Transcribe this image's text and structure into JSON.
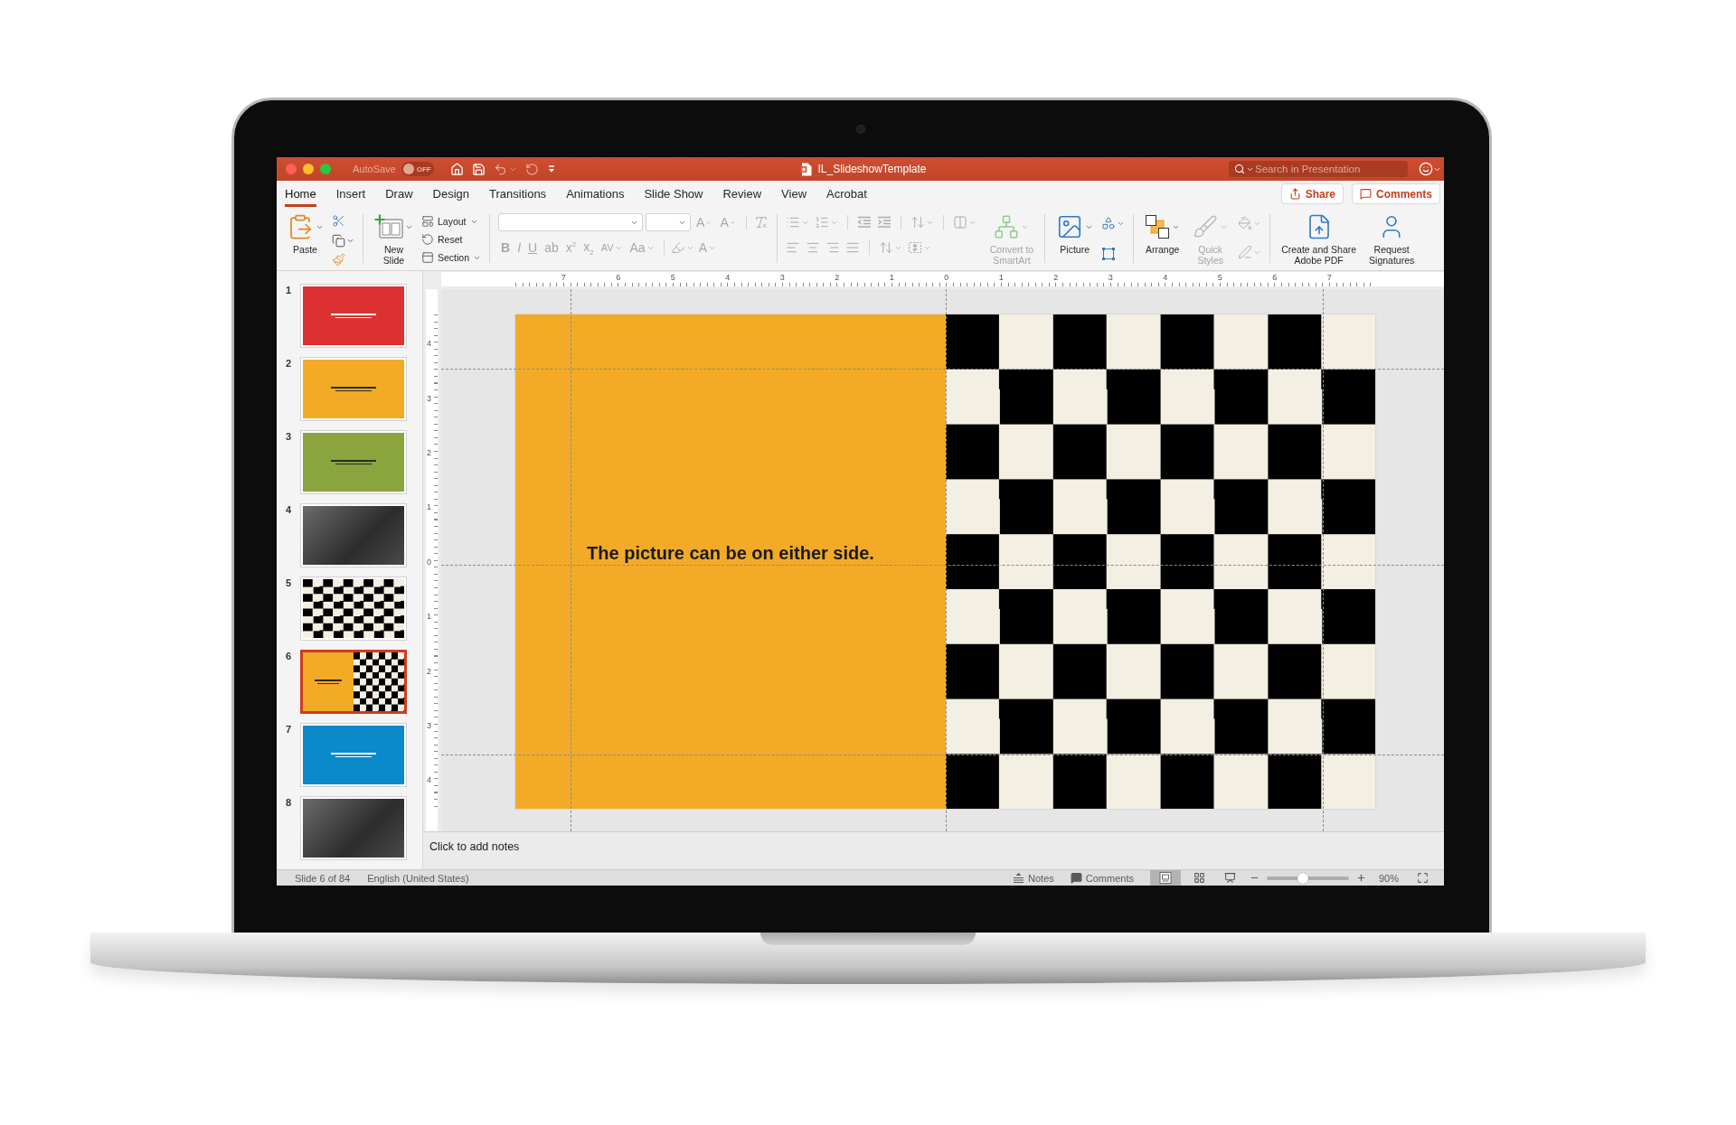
{
  "window": {
    "title": "IL_SlideshowTemplate",
    "autosave": {
      "label": "AutoSave",
      "on": false,
      "toggle_text": "OFF"
    },
    "search": {
      "placeholder": "Search in Presentation"
    }
  },
  "quick_access_toolbar": [
    {
      "kind": "home",
      "disabled": false,
      "dropdown": false
    },
    {
      "kind": "save",
      "disabled": false,
      "dropdown": false
    },
    {
      "kind": "undo",
      "disabled": true,
      "dropdown": true
    },
    {
      "kind": "redo",
      "disabled": true,
      "dropdown": false
    },
    {
      "kind": "customize",
      "disabled": false,
      "dropdown": false
    }
  ],
  "ribbon_tabs": [
    {
      "label": "Home",
      "selected": true
    },
    {
      "label": "Insert",
      "selected": false
    },
    {
      "label": "Draw",
      "selected": false
    },
    {
      "label": "Design",
      "selected": false
    },
    {
      "label": "Transitions",
      "selected": false
    },
    {
      "label": "Animations",
      "selected": false
    },
    {
      "label": "Slide Show",
      "selected": false
    },
    {
      "label": "Review",
      "selected": false
    },
    {
      "label": "View",
      "selected": false
    },
    {
      "label": "Acrobat",
      "selected": false
    }
  ],
  "header_buttons": [
    {
      "kind": "share",
      "label": "Share"
    },
    {
      "kind": "comments",
      "label": "Comments"
    }
  ],
  "ribbon": {
    "paste": {
      "label": "Paste",
      "disabled": false
    },
    "clipboard_buttons": [
      {
        "kind": "cut",
        "disabled": false
      },
      {
        "kind": "copy",
        "disabled": false
      },
      {
        "kind": "format_painter",
        "disabled": false
      }
    ],
    "new_slide": {
      "label": "New\nSlide",
      "disabled": false
    },
    "slide_commands": [
      {
        "kind": "layout",
        "label": "Layout",
        "dropdown": true
      },
      {
        "kind": "reset",
        "label": "Reset",
        "dropdown": false
      },
      {
        "kind": "section",
        "label": "Section",
        "dropdown": true
      }
    ],
    "font": {
      "size_buttons": [
        {
          "kind": "grow",
          "label": "A",
          "disabled": true
        },
        {
          "kind": "shrink",
          "label": "A",
          "disabled": true
        }
      ],
      "clear_button": {
        "disabled": true
      },
      "format_buttons": [
        {
          "kind": "bold",
          "label": "B",
          "disabled": true,
          "dropdown": false
        },
        {
          "kind": "italic",
          "label": "I",
          "disabled": true,
          "dropdown": false
        },
        {
          "kind": "underline",
          "label": "U",
          "disabled": true,
          "dropdown": false
        },
        {
          "kind": "strike",
          "label": "ab",
          "disabled": true,
          "dropdown": false
        },
        {
          "kind": "superscript",
          "label": "x$^{2}$",
          "disabled": true,
          "dropdown": false
        },
        {
          "kind": "subscript",
          "label": "x$_{2}$",
          "disabled": true,
          "dropdown": false
        },
        {
          "kind": "spacing",
          "label": "AV",
          "disabled": true,
          "dropdown": true
        },
        {
          "kind": "case",
          "label": "Aa",
          "disabled": true,
          "dropdown": true
        }
      ],
      "highlight_button": {
        "disabled": true
      },
      "color_button": {
        "label": "A",
        "disabled": true
      }
    },
    "paragraph": {
      "top_row": [
        {
          "buttons": [
            {
              "kind": "bullets",
              "disabled": true,
              "dropdown": true
            },
            {
              "kind": "numbering",
              "disabled": true,
              "dropdown": true
            }
          ]
        },
        {
          "buttons": [
            {
              "kind": "indent_decrease",
              "disabled": true,
              "dropdown": false
            },
            {
              "kind": "indent_increase",
              "disabled": true,
              "dropdown": false
            }
          ]
        },
        {
          "buttons": [
            {
              "kind": "line_spacing",
              "disabled": true,
              "dropdown": true
            }
          ]
        },
        {
          "buttons": [
            {
              "kind": "columns",
              "disabled": true,
              "dropdown": true
            }
          ]
        }
      ],
      "bottom_row": [
        {
          "buttons": [
            {
              "kind": "align_left",
              "disabled": true,
              "dropdown": false
            },
            {
              "kind": "align_center",
              "disabled": true,
              "dropdown": false
            },
            {
              "kind": "align_right",
              "disabled": true,
              "dropdown": false
            },
            {
              "kind": "justify",
              "disabled": true,
              "dropdown": false
            }
          ]
        },
        {
          "buttons": [
            {
              "kind": "text_direction",
              "disabled": true,
              "dropdown": true
            },
            {
              "kind": "align_text",
              "disabled": true,
              "dropdown": true
            }
          ]
        }
      ]
    },
    "smartart": {
      "label": "Convert to\nSmartArt",
      "disabled": true
    },
    "picture": {
      "label": "Picture",
      "disabled": false
    },
    "insert_buttons": [
      {
        "kind": "shapes",
        "disabled": false,
        "dropdown": true
      },
      {
        "kind": "text_box",
        "disabled": false,
        "dropdown": false
      }
    ],
    "arrange": {
      "label": "Arrange",
      "disabled": false
    },
    "quick_styles": {
      "label": "Quick\nStyles",
      "disabled": true
    },
    "shape_format_buttons": [
      {
        "kind": "fill",
        "disabled": true,
        "dropdown": true
      },
      {
        "kind": "outline",
        "disabled": true,
        "dropdown": true
      }
    ],
    "adobe_pdf": {
      "label": "Create and Share\nAdobe PDF",
      "disabled": false
    },
    "signatures": {
      "label": "Request\nSignatures",
      "disabled": false
    }
  },
  "rulers": {
    "horizontal": [
      "7",
      "6",
      "5",
      "4",
      "3",
      "2",
      "1",
      "0",
      "1",
      "2",
      "3",
      "4",
      "5",
      "6",
      "7"
    ],
    "vertical": [
      "4",
      "3",
      "2",
      "1",
      "0",
      "1",
      "2",
      "3",
      "4"
    ]
  },
  "slides": [
    {
      "number": "1",
      "kind": "solid",
      "color": "#dd3131",
      "selected": false
    },
    {
      "number": "2",
      "kind": "solid",
      "color": "#f2aa27",
      "selected": false
    },
    {
      "number": "3",
      "kind": "solid",
      "color": "#8aa43e",
      "selected": false
    },
    {
      "number": "4",
      "kind": "photo",
      "selected": false
    },
    {
      "number": "5",
      "kind": "checker",
      "selected": false
    },
    {
      "number": "6",
      "kind": "split",
      "color": "#f2aa27",
      "selected": true
    },
    {
      "number": "7",
      "kind": "solid",
      "color": "#0b8acb",
      "selected": false
    },
    {
      "number": "8",
      "kind": "photo",
      "selected": false
    }
  ],
  "current_slide": {
    "text": "The picture can be on either side."
  },
  "notes": {
    "placeholder": "Click to add notes"
  },
  "status_bar": {
    "slide_position": "Slide 6 of 84",
    "language": "English (United States)",
    "notes_button": "Notes",
    "comments_button": "Comments",
    "views": [
      {
        "kind": "normal",
        "selected": true
      },
      {
        "kind": "sorter",
        "selected": false
      },
      {
        "kind": "reading",
        "selected": false
      }
    ],
    "zoom": {
      "level": 0.44,
      "reading": "90%"
    }
  }
}
